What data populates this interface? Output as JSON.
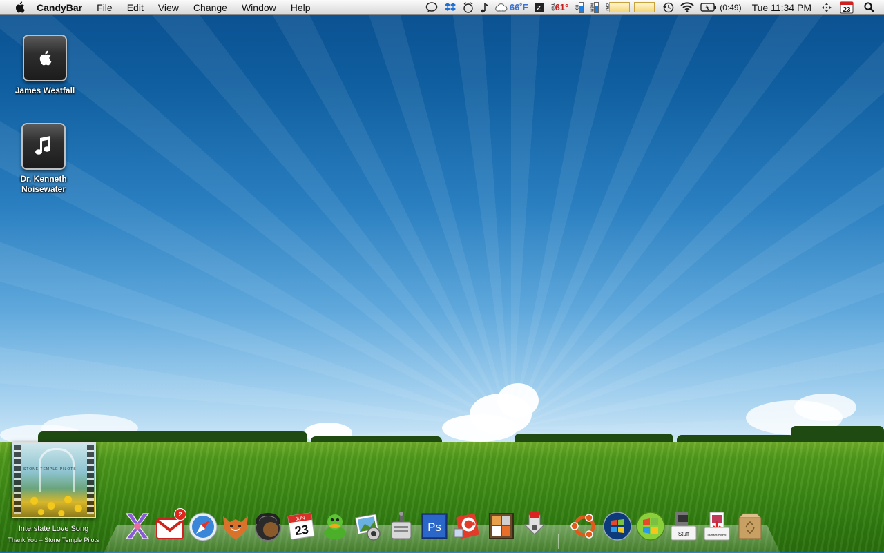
{
  "menubar": {
    "app_name": "CandyBar",
    "items": [
      "File",
      "Edit",
      "View",
      "Change",
      "Window",
      "Help"
    ],
    "status": {
      "weather_temp": "66˚F",
      "cpu_temp": "61°",
      "cpu_temp_label": "TMP",
      "hd_label": "HD",
      "mem_label": "MEM",
      "cpu_label": "CPU",
      "battery_time": "(0:49)",
      "clock": "Tue 11:34 PM",
      "calendar_day": "23"
    }
  },
  "desktop_icons": [
    {
      "label": "James Westfall",
      "icon": "apple-drive-icon"
    },
    {
      "label_line1": "Dr. Kenneth",
      "label_line2": "Noisewater",
      "icon": "music-drive-icon"
    }
  ],
  "now_playing": {
    "title": "Interstate Love Song",
    "subtitle": "Thank You – Stone Temple Pilots",
    "album_band": "STONE TEMPLE PILOTS"
  },
  "dock": {
    "items": [
      {
        "name": "crossover-icon"
      },
      {
        "name": "mail-icon",
        "badge": "2"
      },
      {
        "name": "safari-icon"
      },
      {
        "name": "firefox-icon"
      },
      {
        "name": "music-player-icon"
      },
      {
        "name": "ical-icon",
        "month": "JUN",
        "day": "23"
      },
      {
        "name": "adium-icon"
      },
      {
        "name": "iphoto-icon"
      },
      {
        "name": "system-utility-icon"
      },
      {
        "name": "photoshop-icon",
        "label": "Ps"
      },
      {
        "name": "candybar-app-icon"
      },
      {
        "name": "dashboard-widgets-icon"
      },
      {
        "name": "mac-utility-icon"
      },
      {
        "name": "ubuntu-icon"
      },
      {
        "name": "windows-vista-icon"
      },
      {
        "name": "windows-xp-icon"
      },
      {
        "name": "stuff-folder-icon",
        "label": "Stuff"
      },
      {
        "name": "downloads-folder-icon",
        "label": "Downloads"
      },
      {
        "name": "trash-icon"
      }
    ]
  },
  "colors": {
    "sky_top": "#0a4f8f",
    "sky_horizon": "#d7ecf9",
    "grass": "#3d8a15",
    "badge": "#e0261c"
  }
}
